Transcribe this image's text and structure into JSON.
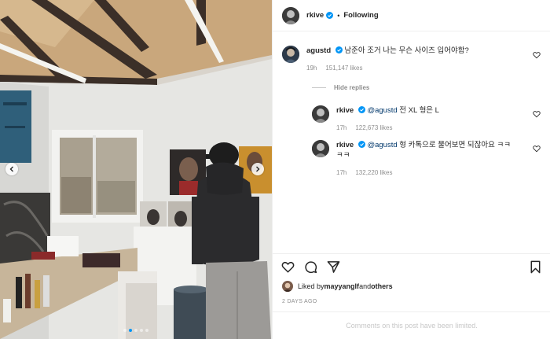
{
  "post": {
    "author": "rkive",
    "follow_status": "Following",
    "separator": "•"
  },
  "comments": [
    {
      "username": "agustd",
      "text": "남준아 조거 나는 무슨 사이즈 입어야함?",
      "time": "19h",
      "likes": "151,147 likes"
    }
  ],
  "hide_replies_label": "Hide replies",
  "replies": [
    {
      "username": "rkive",
      "mention": "@agustd",
      "text": " 전 XL 형은 L",
      "time": "17h",
      "likes": "122,673 likes"
    },
    {
      "username": "rkive",
      "mention": "@agustd",
      "text_line1": " 형 카톡으로 물어보면 되잖아요 ㅋㅋ",
      "text_line2": "ㅋㅋ",
      "time": "17h",
      "likes": "132,220 likes"
    }
  ],
  "liked_by": {
    "prefix": "Liked by ",
    "user": "mayyanglf",
    "middle": " and ",
    "others": "others"
  },
  "posted_ago": "2 DAYS AGO",
  "comments_limited": "Comments on this post have been limited.",
  "carousel": {
    "slide_count": 5,
    "active_slide": 2
  },
  "colors": {
    "verified": "#0095f6",
    "mention": "#00376b",
    "muted": "#8e8e8e"
  },
  "icons": [
    "verified-badge-icon",
    "heart-icon",
    "comment-icon",
    "share-icon",
    "bookmark-icon",
    "chevron-left-icon",
    "chevron-right-icon"
  ]
}
